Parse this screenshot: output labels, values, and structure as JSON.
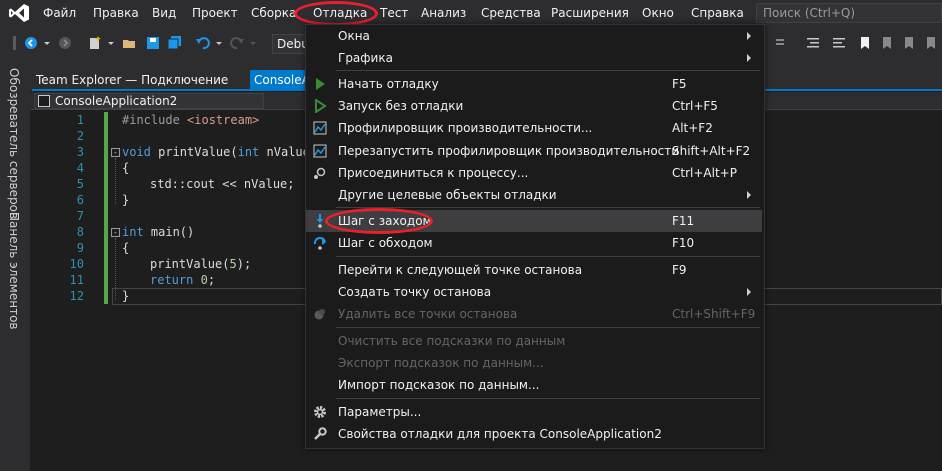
{
  "menubar": {
    "items": [
      "Файл",
      "Правка",
      "Вид",
      "Проект",
      "Сборка",
      "Отладка",
      "Тест",
      "Анализ",
      "Средства",
      "Расширения",
      "Окно",
      "Справка"
    ],
    "search_placeholder": "Поиск (Ctrl+Q)",
    "highlight_color": "#e8202a"
  },
  "toolbar": {
    "config_value": "Debu"
  },
  "side_strip": {
    "tabs": [
      "Обозреватель серверов",
      "Панель элементов"
    ]
  },
  "tabs": {
    "team_explorer": "Team Explorer — Подключение",
    "console": "ConsoleAp"
  },
  "editor": {
    "nav_project": "ConsoleApplication2",
    "line_numbers": [
      "1",
      "2",
      "3",
      "4",
      "5",
      "6",
      "7",
      "8",
      "9",
      "10",
      "11",
      "12"
    ],
    "code": {
      "l1_pre": "#include",
      "l1_rest": " <iostream>",
      "l3_kw": "void",
      "l3_mid": " printValue(",
      "l3_kw2": "int",
      "l3_rest": " nValue",
      "l4": "{",
      "l5": "std::cout << nValue;",
      "l6": "}",
      "l8_kw": "int",
      "l8_rest": " main()",
      "l9": "{",
      "l10_a": "printValue(",
      "l10_num": "5",
      "l10_b": ");",
      "l11_kw": "return",
      "l11_num": " 0",
      "l11_b": ";",
      "l12": "}"
    },
    "accent": "#007acc"
  },
  "debug_menu": {
    "items": [
      {
        "label": "Окна",
        "shortcut": "",
        "submenu": true,
        "icon": ""
      },
      {
        "label": "Графика",
        "shortcut": "",
        "submenu": true,
        "icon": ""
      },
      {
        "label": "Начать отладку",
        "shortcut": "F5",
        "icon": "play-icon"
      },
      {
        "label": "Запуск без отладки",
        "shortcut": "Ctrl+F5",
        "icon": "play-outline-icon"
      },
      {
        "label": "Профилировщик производительности...",
        "shortcut": "Alt+F2",
        "icon": "profiler-icon"
      },
      {
        "label": "Перезапустить профилировщик производительности",
        "shortcut": "Shift+Alt+F2",
        "icon": "profiler-restart-icon"
      },
      {
        "label": "Присоединиться к процессу...",
        "shortcut": "Ctrl+Alt+P",
        "icon": "attach-icon"
      },
      {
        "label": "Другие целевые объекты отладки",
        "shortcut": "",
        "submenu": true,
        "icon": ""
      },
      {
        "label": "Шаг с заходом",
        "shortcut": "F11",
        "icon": "step-into-icon"
      },
      {
        "label": "Шаг с обходом",
        "shortcut": "F10",
        "icon": "step-over-icon"
      },
      {
        "label": "Перейти к следующей точке останова",
        "shortcut": "F9",
        "icon": ""
      },
      {
        "label": "Создать точку останова",
        "shortcut": "",
        "submenu": true,
        "icon": ""
      },
      {
        "label": "Удалить все точки останова",
        "shortcut": "Ctrl+Shift+F9",
        "icon": "delete-breakpoints-icon"
      },
      {
        "label": "Очистить все подсказки по данным",
        "shortcut": "",
        "icon": ""
      },
      {
        "label": "Экспорт подсказок по данным...",
        "shortcut": "",
        "icon": ""
      },
      {
        "label": "Импорт подсказок по данным...",
        "shortcut": "",
        "icon": ""
      },
      {
        "label": "Параметры...",
        "shortcut": "",
        "icon": "gear-icon"
      },
      {
        "label": "Свойства отладки для проекта ConsoleApplication2",
        "shortcut": "",
        "icon": "wrench-icon"
      }
    ]
  }
}
